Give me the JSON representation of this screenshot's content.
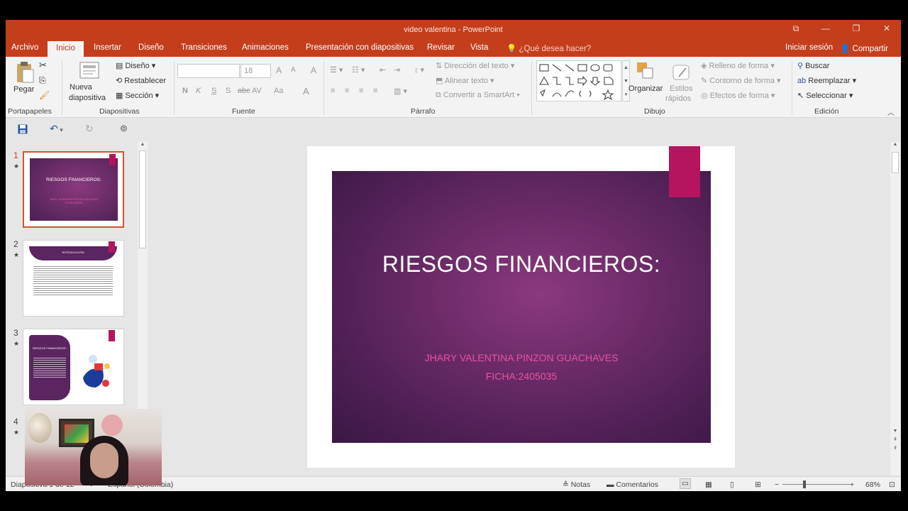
{
  "window": {
    "title": "video valentina - PowerPoint",
    "controls": [
      "⧉",
      "—",
      "❐",
      "✕"
    ]
  },
  "tabs": [
    {
      "label": "Archivo",
      "active": false
    },
    {
      "label": "Inicio",
      "active": true
    },
    {
      "label": "Insertar",
      "active": false
    },
    {
      "label": "Diseño",
      "active": false
    },
    {
      "label": "Transiciones",
      "active": false
    },
    {
      "label": "Animaciones",
      "active": false
    },
    {
      "label": "Presentación con diapositivas",
      "active": false
    },
    {
      "label": "Revisar",
      "active": false
    },
    {
      "label": "Vista",
      "active": false
    }
  ],
  "tell_me": "¿Qué desea hacer?",
  "sign_in": "Iniciar sesión",
  "share": "Compartir",
  "ribbon": {
    "clipboard": {
      "paste": "Pegar",
      "label": "Portapapeles"
    },
    "slides": {
      "new_slide_line1": "Nueva",
      "new_slide_line2": "diapositiva",
      "layout": "Diseño",
      "reset": "Restablecer",
      "section": "Sección",
      "label": "Diapositivas"
    },
    "font": {
      "font_name": "",
      "font_size": "18",
      "grow": "A",
      "shrink": "A",
      "clear": "A",
      "bold": "N",
      "italic": "K",
      "underline": "S",
      "shadow": "S",
      "strike": "abc",
      "spacing": "AV",
      "case": "Aa",
      "color": "A",
      "label": "Fuente"
    },
    "paragraph": {
      "text_direction": "Dirección del texto",
      "align_text": "Alinear texto",
      "smartart": "Convertir a SmartArt",
      "label": "Párrafo"
    },
    "drawing": {
      "arrange": "Organizar",
      "quick_styles_line1": "Estilos",
      "quick_styles_line2": "rápidos",
      "shape_fill": "Relleno de forma",
      "shape_outline": "Contorno de forma",
      "shape_effects": "Efectos de forma",
      "label": "Dibujo"
    },
    "editing": {
      "find": "Buscar",
      "replace": "Reemplazar",
      "select": "Seleccionar",
      "label": "Edición"
    }
  },
  "thumbnails": [
    {
      "number": "1",
      "title": "RIESGOS FINANCIEROS:",
      "subtitle": "JHARY VALENTINA PINZON GUACHAVES FICHA:2405035"
    },
    {
      "number": "2",
      "title": "INTRODUCCIÓN"
    },
    {
      "number": "3",
      "title": "RIESGOS FINANCIEROS:"
    },
    {
      "number": "4"
    }
  ],
  "slide": {
    "title": "RIESGOS FINANCIEROS:",
    "author": "JHARY VALENTINA PINZON GUACHAVES",
    "ficha": "FICHA:2405035"
  },
  "status": {
    "slide_info": "Diapositiva 1 de 12",
    "language": "Español (Colombia)",
    "notes": "Notas",
    "comments": "Comentarios",
    "zoom": "68%"
  },
  "colors": {
    "accent": "#c43e1c",
    "slide_bg": "#5a2560",
    "bookmark": "#b5155e",
    "subtitle": "#e5539f"
  }
}
